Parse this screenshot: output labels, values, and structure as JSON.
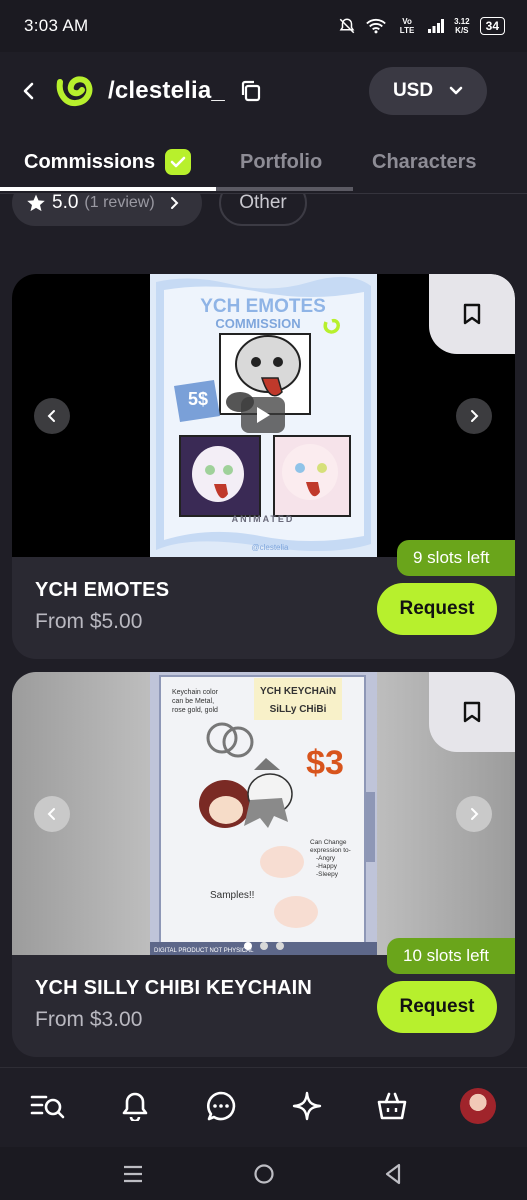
{
  "status_bar": {
    "time": "3:03 AM",
    "network_label": "Vo LTE",
    "speed_value": "3.12",
    "speed_unit": "K/S",
    "battery": "34"
  },
  "header": {
    "username": "/clestelia_",
    "currency": "USD"
  },
  "tabs": [
    {
      "label": "Commissions",
      "active": true
    },
    {
      "label": "Portfolio",
      "active": false
    },
    {
      "label": "Characters",
      "active": false
    }
  ],
  "filters": {
    "rating": "5.0",
    "reviews": "(1 review)",
    "other": "Other"
  },
  "listings": [
    {
      "title": "YCH EMOTES",
      "price": "From $5.00",
      "slots": "9 slots left",
      "request_label": "Request",
      "art": {
        "heading": "YCH EMOTES",
        "subheading": "COMMISSION",
        "price_tag": "5$",
        "caption": "ANIMATED",
        "signature": "@clestelia"
      }
    },
    {
      "title": "YCH SILLY CHIBI KEYCHAIN",
      "price": "From $3.00",
      "slots": "10 slots left",
      "request_label": "Request",
      "art": {
        "heading_1": "YCH KEYCHAiN",
        "heading_2": "SiLLy CHiBi",
        "price_tag": "$3",
        "note_left_1": "Keychain color",
        "note_left_2": "can be Metal,",
        "note_left_3": "rose gold, gold",
        "note_right_1": "Can Change",
        "note_right_2": "expression to-",
        "note_right_3": "-Angry",
        "note_right_4": "-Happy",
        "note_right_5": "-Sleepy",
        "samples": "Samples!!",
        "footer": "DIGITAL PRODUCT NOT PHYSICAL"
      }
    }
  ],
  "colors": {
    "accent": "#b7f02d",
    "slots_badge": "#6aa51b",
    "background": "#1f1e26",
    "card": "#2a2932"
  },
  "bottom_nav": [
    "search-list-icon",
    "bell-icon",
    "chat-icon",
    "sparkle-icon",
    "shopping-bag-icon",
    "avatar"
  ]
}
